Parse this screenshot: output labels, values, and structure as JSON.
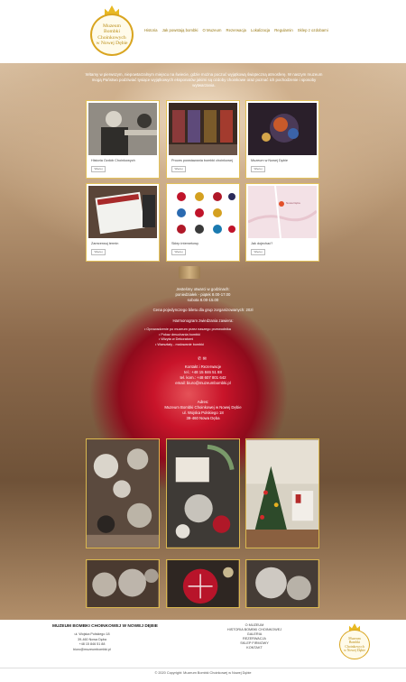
{
  "logo": {
    "lines": [
      "Muzeum",
      "Bombki",
      "Choinkowych",
      "w Nowej Dębie"
    ]
  },
  "nav": [
    "Historia",
    "Jak powstają bombki",
    "O Muzeum",
    "Rezerwacja",
    "Lokalizacja",
    "Regulamin",
    "Sklep z ozdobami"
  ],
  "intro": "Witamy w pierwszym, niepowtarzalnym miejscu na świecie, gdzie można poczuć wyjątkową świąteczną atmosferę. W naszym muzeum mogą Państwo podziwiać tysiące wyjątkowych eksponatów jakimi są ozdoby choinkowe oraz poznać ich pochodzenie i sposoby wytwarzania.",
  "cards": [
    {
      "label": "Historia Ozdób Choinkowych",
      "button": "Więcej"
    },
    {
      "label": "Proces powstawania bombki choinkowej",
      "button": "Więcej"
    },
    {
      "label": "Muzeum w Nowej Dębie",
      "button": "Więcej"
    },
    {
      "label": "Zarezerwuj termin",
      "button": "Więcej"
    },
    {
      "label": "Sklep internetowy",
      "button": "Więcej"
    },
    {
      "label": "Jak dojechać?",
      "button": "Więcej"
    }
  ],
  "map_label": "Nowa Dęba",
  "info": {
    "open_title": "Jesteśmy otwarci w godzinach:",
    "weekdays": "poniedziałek - piątek 8.00-17.00",
    "saturday": "sobota 8.00-15.00",
    "price": "Cena pojedynczego biletu dla grup zorganizowanych: 20zł",
    "schedule_title": "Harmonogram zwiedzania zawiera:",
    "schedule": [
      "Oprowadzenie po muzeum przez naszego przewodnika",
      "Pokaz dmuchania bombki",
      "Wizyta w Dekoratorni",
      "Warsztaty - malowanie bombki"
    ],
    "contact_title": "Kontakt i Rezerwacje",
    "tel": "tel.: +48 15 846 51 88",
    "tel_kom": "tel. kom.: +48 607 801 642",
    "email": "email: biuro@muzeumbombki.pl",
    "address_title": "Adres:",
    "address_name": "Muzeum Bombki Choinkowej w Nowej Dębie",
    "street": "ul. Wojska Polskiego 18",
    "city": "39-460 Nowa Dęba"
  },
  "footer": {
    "title": "MUZEUM BOMBKI CHOINKOWEJ W NOWEJ DĘBIE",
    "address": [
      "ul. Wojska Polskiego 18",
      "39-460 Nowa Dęba",
      "+48 15 846 51 88",
      "biuro@muzeumbombki.pl"
    ],
    "links": [
      "O MUZEUM",
      "HISTORIA BOMBKI CHOINKOWEJ",
      "GALERIA",
      "REZERWACJA",
      "SKLEP FIRMOWY",
      "KONTAKT"
    ],
    "logo_lines": [
      "Muzeum",
      "Bombki",
      "Choinkowych",
      "w Nowej Dębie"
    ],
    "copyright": "© 2020 Copyright: Muzeum Bombki Choinkowej w Nowej Dębie"
  },
  "colors": {
    "gold": "#d9b74f",
    "ornament_red": "#c9142a"
  }
}
